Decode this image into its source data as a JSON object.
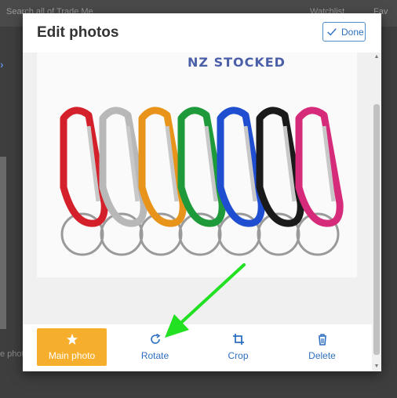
{
  "background": {
    "search_placeholder": "Search all of Trade Me",
    "watchlist": "Watchlist",
    "favourites": "Fav",
    "left_fragment": "e phot"
  },
  "modal": {
    "title": "Edit photos",
    "done_label": "Done"
  },
  "photo": {
    "brand_text": "NZ STOCKED",
    "carabiner_colors": [
      "#d3202a",
      "#b8b8b8",
      "#e8931a",
      "#1f9a3a",
      "#1f4fd0",
      "#1a1a1a",
      "#d62a7a"
    ]
  },
  "toolbar": {
    "main_photo": "Main photo",
    "rotate": "Rotate",
    "crop": "Crop",
    "delete": "Delete"
  },
  "colors": {
    "accent_blue": "#2f6fbf",
    "main_photo_bg": "#f6ae2d",
    "annotation_arrow": "#22e022"
  }
}
